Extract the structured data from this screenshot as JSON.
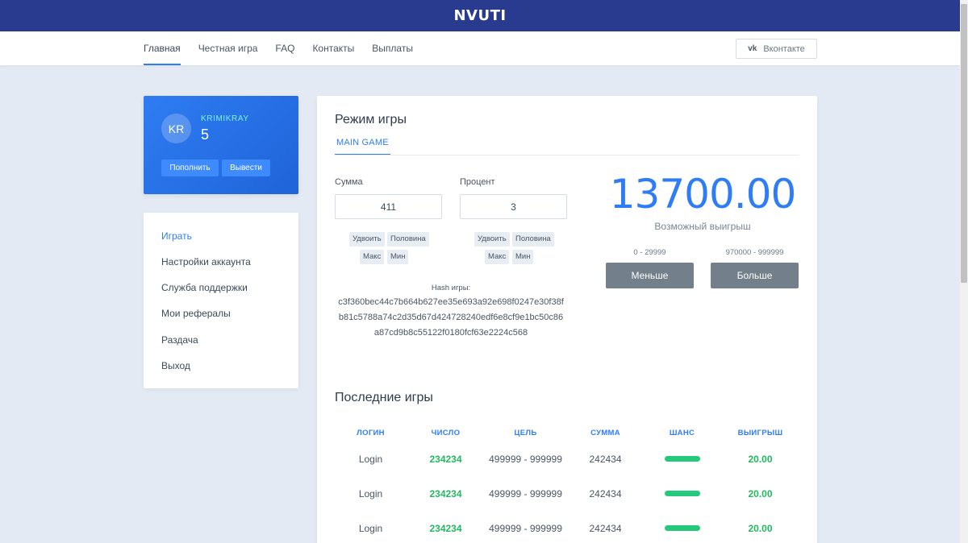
{
  "header": {
    "brand": "NVUTI"
  },
  "nav": {
    "links": [
      "Главная",
      "Честная игра",
      "FAQ",
      "Контакты",
      "Выплаты"
    ],
    "vk_label": "Вконтакте"
  },
  "user": {
    "initials": "KR",
    "name": "KRIMIKRAY",
    "balance": "5",
    "deposit_label": "Пополнить",
    "withdraw_label": "Вывести"
  },
  "menu": {
    "items": [
      "Играть",
      "Настройки аккаунта",
      "Служба поддержки",
      "Мои рефералы",
      "Раздача",
      "Выход"
    ]
  },
  "game": {
    "title": "Режим игры",
    "tab": "MAIN GAME",
    "amount_label": "Сумма",
    "amount_value": "411",
    "percent_label": "Процент",
    "percent_value": "3",
    "btn_double": "Удвоить",
    "btn_half": "Половина",
    "btn_max": "Макс",
    "btn_min": "Мин",
    "hash_label": "Hash игры:",
    "hash_lines": [
      "c3f360bec44c7b664b627ee35e693a92e698f0247e30f38f",
      "b81c5788a74c2d35d67d424728240edf6e8cf9e1bc50c86",
      "a87cd9b8c55122f0180fcf63e2224c568"
    ],
    "possible_win": "13700.00",
    "possible_win_label": "Возможный выигрыш",
    "range_low": "0 - 29999",
    "range_high": "970000 - 999999",
    "btn_less": "Меньше",
    "btn_more": "Больше"
  },
  "recent": {
    "title": "Последние игры",
    "columns": [
      "ЛОГИН",
      "ЧИСЛО",
      "ЦЕЛЬ",
      "СУММА",
      "ШАНС",
      "ВЫИГРЫШ"
    ],
    "rows": [
      {
        "login": "Login",
        "number": "234234",
        "target": "499999 - 999999",
        "sum": "242434",
        "chance": 1.0,
        "win": "20.00"
      },
      {
        "login": "Login",
        "number": "234234",
        "target": "499999 - 999999",
        "sum": "242434",
        "chance": 1.0,
        "win": "20.00"
      },
      {
        "login": "Login",
        "number": "234234",
        "target": "499999 - 999999",
        "sum": "242434",
        "chance": 1.0,
        "win": "20.00"
      }
    ]
  },
  "colors": {
    "topbar": "#283b8f",
    "accent": "#2f7df6",
    "success": "#22b860",
    "bet_button": "#747f8c"
  }
}
